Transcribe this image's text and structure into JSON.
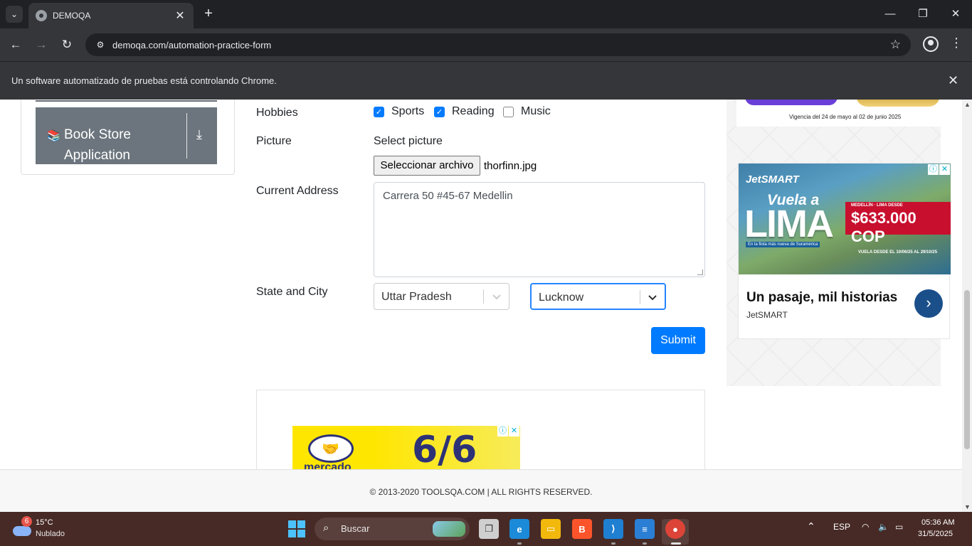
{
  "browser": {
    "tab_title": "DEMOQA",
    "url": "demoqa.com/automation-practice-form",
    "automation_notice": "Un software automatizado de pruebas está controlando Chrome."
  },
  "sidebar": {
    "book_store_label": "Book Store Application"
  },
  "form": {
    "hobbies_label": "Hobbies",
    "hobbies": [
      {
        "label": "Sports",
        "checked": true
      },
      {
        "label": "Reading",
        "checked": true
      },
      {
        "label": "Music",
        "checked": false
      }
    ],
    "picture_label": "Picture",
    "select_picture_text": "Select picture",
    "file_button_label": "Seleccionar archivo",
    "file_name": "thorfinn.jpg",
    "address_label": "Current Address",
    "address_value": "Carrera 50 #45-67 Medellin",
    "state_city_label": "State and City",
    "state_value": "Uttar Pradesh",
    "city_value": "Lucknow",
    "submit_label": "Submit"
  },
  "ads": {
    "promo_validity": "Vigencia del 24 de mayo al 02 de junio 2025",
    "jetsmart_brand": "JetSMART",
    "jetsmart_vuela": "Vuela a",
    "jetsmart_lima": "LIMA",
    "jetsmart_route": "MEDELLÍN · LIMA DESDE",
    "jetsmart_price": "$633.000 COP",
    "jetsmart_fleet": "En la flota más nueva de Suramérica",
    "jetsmart_dates": "VUELA DESDE EL 10/06/25 AL 29/10/25",
    "jetsmart_headline": "Un pasaje, mil historias",
    "jetsmart_advertiser": "JetSMART",
    "meli_word": "mercado",
    "meli_date": "6/6"
  },
  "footer": {
    "copyright": "© 2013-2020 TOOLSQA.COM | ALL RIGHTS RESERVED."
  },
  "taskbar": {
    "weather_badge": "6",
    "temperature": "15°C",
    "weather_desc": "Nublado",
    "search_placeholder": "Buscar",
    "language": "ESP",
    "time": "05:36 AM",
    "date": "31/5/2025"
  },
  "colors": {
    "primary": "#007bff",
    "select_focus": "#2684ff",
    "sidebar_button": "#6c757d",
    "taskbar": "#472a26"
  }
}
